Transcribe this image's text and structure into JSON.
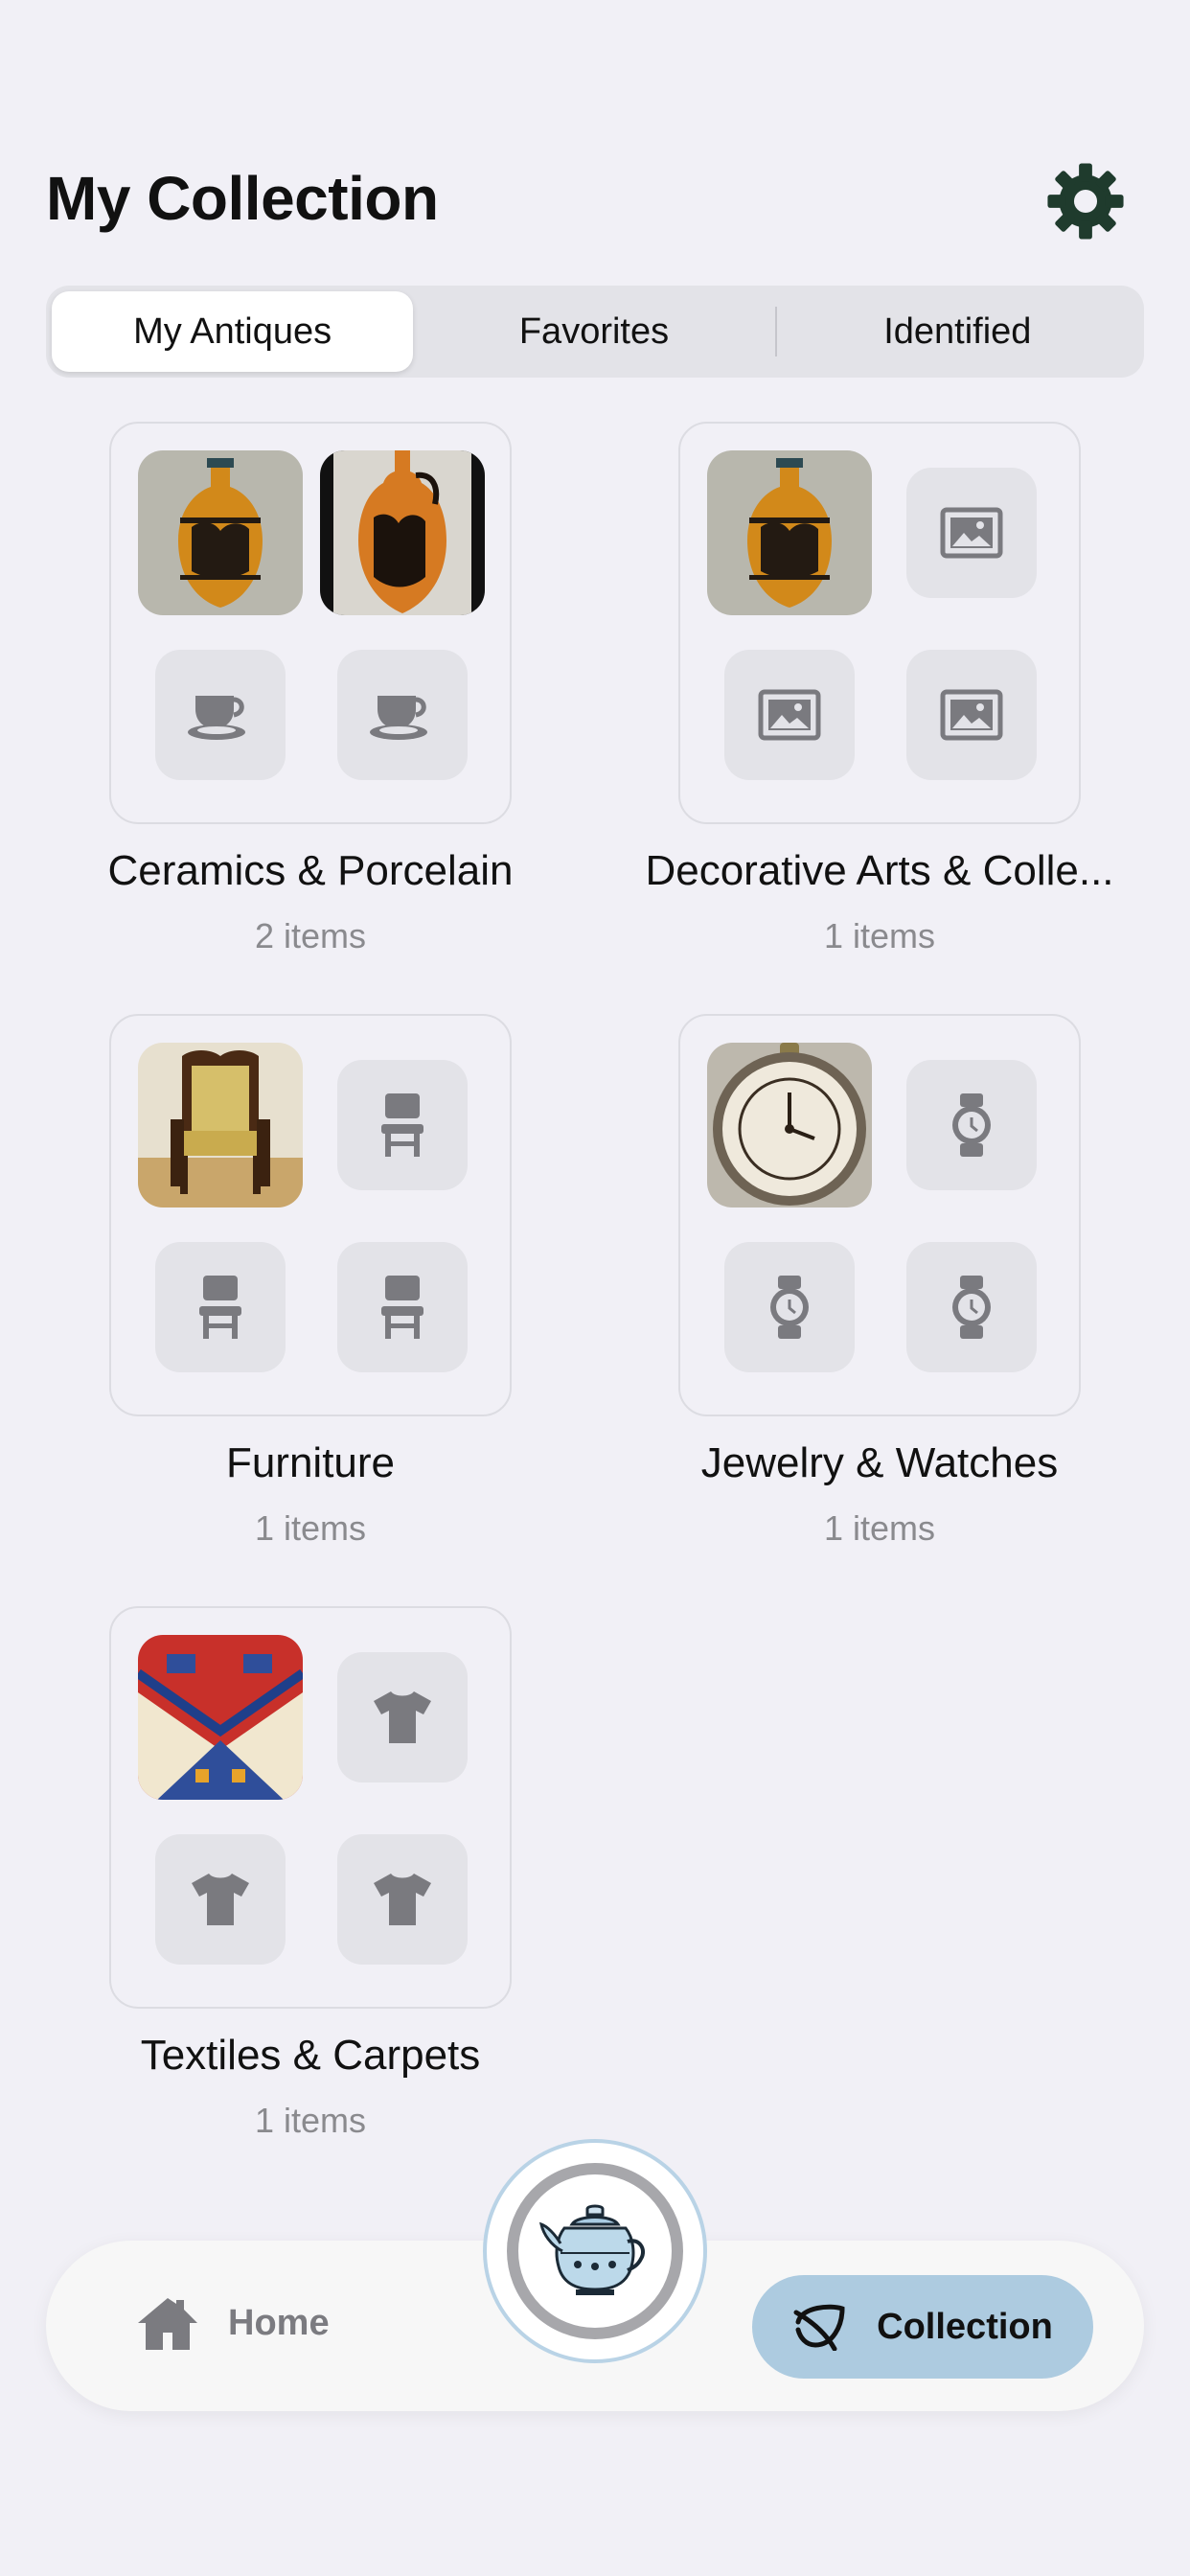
{
  "header": {
    "title": "My Collection",
    "settings_icon": "gear-icon",
    "accent": "#1f3b2d"
  },
  "segments": [
    {
      "label": "My Antiques",
      "selected": true
    },
    {
      "label": "Favorites",
      "selected": false
    },
    {
      "label": "Identified",
      "selected": false
    }
  ],
  "categories": [
    {
      "name": "Ceramics & Porcelain",
      "count": "2 items",
      "placeholder_icon": "teacup-icon"
    },
    {
      "name": "Decorative Arts & Colle...",
      "count": "1 items",
      "placeholder_icon": "image-icon"
    },
    {
      "name": "Furniture",
      "count": "1 items",
      "placeholder_icon": "chair-icon"
    },
    {
      "name": "Jewelry & Watches",
      "count": "1 items",
      "placeholder_icon": "watch-icon"
    },
    {
      "name": "Textiles & Carpets",
      "count": "1 items",
      "placeholder_icon": "tshirt-icon"
    }
  ],
  "tabbar": {
    "home_label": "Home",
    "collection_label": "Collection",
    "scan_icon": "teapot-icon",
    "active_color": "#adcbe0"
  }
}
